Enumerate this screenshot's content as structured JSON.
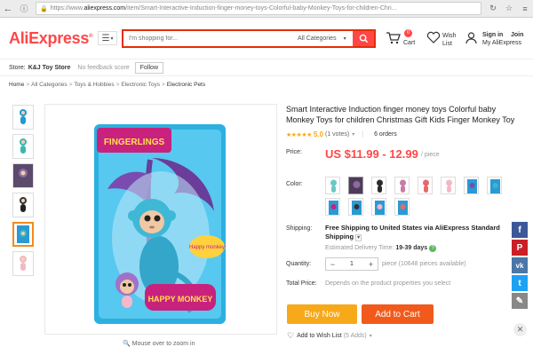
{
  "browser": {
    "url_prefix": "https://www.",
    "url_domain": "aliexpress.com",
    "url_path": "/item/Smart-Interactive-Induction-finger-money-toys-Colorful-baby-Monkey-Toys-for-children-Chri..."
  },
  "header": {
    "logo": "AliExpress",
    "search_placeholder": "I'm shopping for...",
    "search_category": "All Categories",
    "cart_count": "0",
    "cart_label": "Cart",
    "wish_label": "Wish List",
    "signin": "Sign in",
    "join": "Join",
    "my_account": "My AliExpress"
  },
  "store": {
    "label": "Store:",
    "name": "K&J Toy Store",
    "score": "No feedback score",
    "follow": "Follow"
  },
  "breadcrumb": [
    "Home",
    "All Categories",
    "Toys & Hobbies",
    "Electronic Toys",
    "Electronic Pets"
  ],
  "gallery": {
    "zoom_hint": "Mouse over to zoom in",
    "package_brand": "FINGERLINGS",
    "package_name": "HAPPY MONKEY",
    "package_tag": "Happy monkey"
  },
  "product": {
    "title": "Smart Interactive Induction finger money toys Colorful baby Monkey Toys for children Christmas Gift Kids Finger Monkey Toy",
    "stars": "★★★★★",
    "rating": "5.0",
    "votes": "(1 votes)",
    "orders": "6 orders",
    "price_label": "Price:",
    "price": "US $11.99 - 12.99",
    "per_piece": "/ piece",
    "color_label": "Color:",
    "shipping_label": "Shipping:",
    "shipping_text": "Free Shipping to United States via AliExpress Standard Shipping",
    "delivery_label": "Estimated Delivery Time:",
    "delivery_days": "19-39 days",
    "quantity_label": "Quantity:",
    "quantity": "1",
    "qty_unit": "piece (10648 pieces available)",
    "total_label": "Total Price:",
    "total_value": "Depends on the product properties you select",
    "buy_now": "Buy Now",
    "add_cart": "Add to Cart",
    "wishlist": "Add to Wish List",
    "wishlist_adds": "(5 Adds)"
  },
  "colors": {
    "accent": "#ff4747",
    "buy_now": "#f7a91a",
    "add_cart": "#f25a1b"
  }
}
